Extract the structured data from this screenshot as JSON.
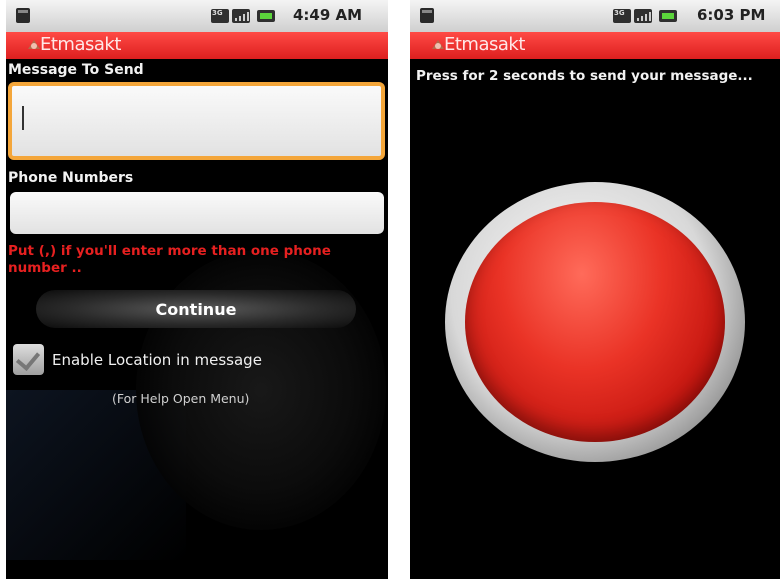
{
  "left_screen": {
    "status_time": "4:49 AM",
    "app_title": "Etmasakt",
    "message_label": "Message To Send",
    "message_value": "",
    "phone_label": "Phone Numbers",
    "phone_value": "",
    "hint_text": "Put (,) if you'll enter more than one phone number ..",
    "continue_label": "Continue",
    "location_checkbox_label": "Enable Location in message",
    "help_text": "(For Help Open Menu)"
  },
  "right_screen": {
    "status_time": "6:03 PM",
    "app_title": "Etmasakt",
    "instruction_text": "Press for 2 seconds to send your message..."
  },
  "colors": {
    "titlebar_red": "#e52a27",
    "focus_orange": "#f4a63a",
    "hint_red": "#e62020",
    "panic_button_red": "#e23a2e"
  },
  "icons": {
    "sd_card": "sd-card-icon",
    "network_3g": "network-3g-icon",
    "signal": "signal-icon",
    "battery": "battery-icon",
    "app_logo": "app-logo-icon"
  }
}
